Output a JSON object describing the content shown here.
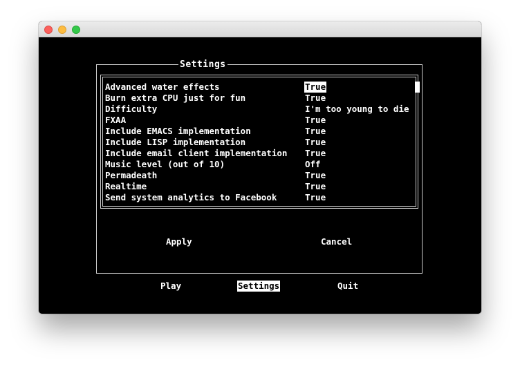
{
  "dialog": {
    "title": "Settings",
    "settings": [
      {
        "label": "Advanced water effects",
        "value": "True",
        "selected": true
      },
      {
        "label": "Burn extra CPU just for fun",
        "value": "True"
      },
      {
        "label": "Difficulty",
        "value": "I'm too young to die"
      },
      {
        "label": "FXAA",
        "value": "True"
      },
      {
        "label": "Include EMACS implementation",
        "value": "True"
      },
      {
        "label": "Include LISP implementation",
        "value": "True"
      },
      {
        "label": "Include email client implementation",
        "value": "True"
      },
      {
        "label": "Music level (out of 10)",
        "value": "Off"
      },
      {
        "label": "Permadeath",
        "value": "True"
      },
      {
        "label": "Realtime",
        "value": "True"
      },
      {
        "label": "Send system analytics to Facebook",
        "value": "True"
      }
    ],
    "apply_label": "Apply",
    "cancel_label": "Cancel"
  },
  "menu": {
    "play_label": "Play",
    "settings_label": "Settings",
    "quit_label": "Quit",
    "active": "Settings"
  },
  "colors": {
    "background": "#000000",
    "text": "#ffffff",
    "highlight": "#ffffff"
  }
}
